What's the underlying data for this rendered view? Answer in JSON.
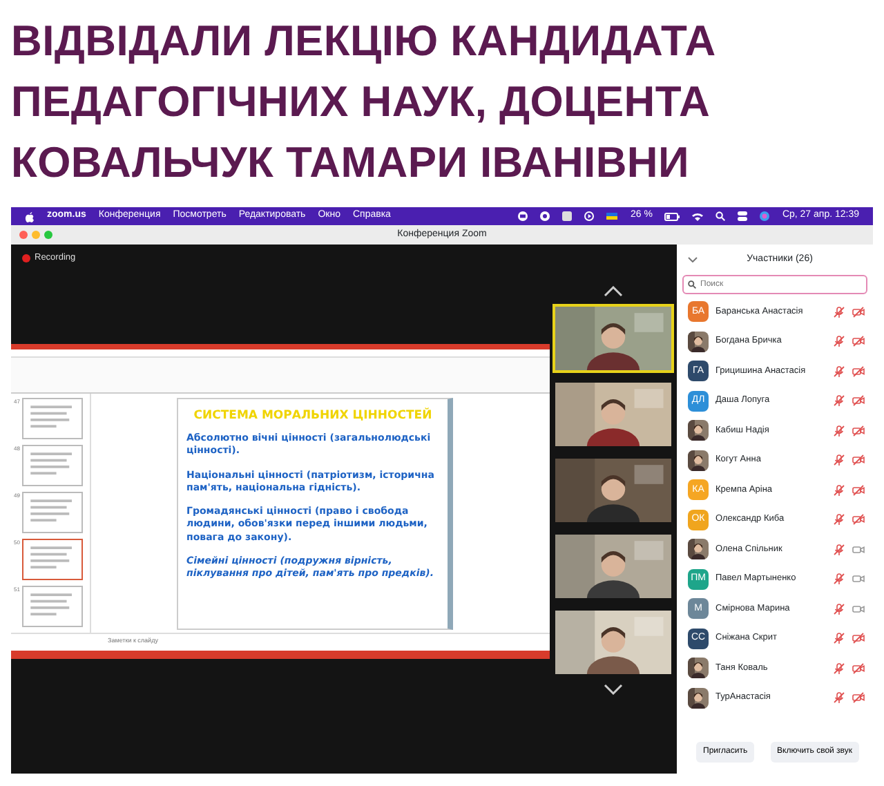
{
  "heading": {
    "lines": [
      "ВІДВІДАЛИ ЛЕКЦІЮ КАНДИДАТА",
      "ПЕДАГОГІЧНИХ НАУК, ДОЦЕНТА",
      "КОВАЛЬЧУК ТАМАРИ ІВАНІВНИ"
    ]
  },
  "menu_bar": {
    "app": "zoom.us",
    "items": [
      "Конференция",
      "Посмотреть",
      "Редактировать",
      "Окно",
      "Справка"
    ],
    "battery": "26 %",
    "clock": "Ср, 27 апр.  12:39"
  },
  "window": {
    "title": "Конференция Zoom"
  },
  "recording": {
    "label": "Recording"
  },
  "presentation": {
    "thumbnails": [
      {
        "number": "47",
        "selected": false
      },
      {
        "number": "48",
        "selected": false
      },
      {
        "number": "49",
        "selected": false
      },
      {
        "number": "50",
        "selected": true
      },
      {
        "number": "51",
        "selected": false
      }
    ],
    "slide": {
      "title": "СИСТЕМА МОРАЛЬНИХ ЦІННОСТЕЙ",
      "paragraphs": [
        {
          "text": "Абсолютно вічні цінності (загальнолюдські цінності).",
          "italic": false
        },
        {
          "text": "Національні цінності (патріотизм, історична пам'ять, національна гідність).",
          "italic": false
        },
        {
          "text": "Громадянські цінності (право і свобода людини, обов'язки перед іншими людьми, повага до закону).",
          "italic": false
        },
        {
          "text": "Сімейні цінності (подружня вірність, піклування про дітей, пам'ять про предків).",
          "italic": true
        }
      ]
    },
    "notes_placeholder": "Заметки к слайду"
  },
  "videos": [
    {
      "active_speaker": true
    },
    {
      "active_speaker": false
    },
    {
      "active_speaker": false
    },
    {
      "active_speaker": false
    },
    {
      "active_speaker": false
    }
  ],
  "participants": {
    "title": "Участники (26)",
    "search": {
      "placeholder": "Поиск"
    },
    "people": [
      {
        "name": "Баранська Анастасія",
        "avatar": {
          "kind": "initials",
          "initials": "БА",
          "color": "#e8772e"
        },
        "muted": true,
        "video_on": false
      },
      {
        "name": "Богдана Бричка",
        "muted": true,
        "video_on": false
      },
      {
        "name": "Грицишина Анастасія",
        "avatar": {
          "kind": "initials",
          "initials": "ГА",
          "color": "#2e4a6b"
        },
        "muted": true,
        "video_on": false
      },
      {
        "name": "Даша Лопуга",
        "avatar": {
          "kind": "initials",
          "initials": "ДЛ",
          "color": "#2d8fd8"
        },
        "muted": true,
        "video_on": false
      },
      {
        "name": "Кабиш Надія",
        "muted": true,
        "video_on": false
      },
      {
        "name": "Когут Анна",
        "muted": true,
        "video_on": false
      },
      {
        "name": "Кремпа Аріна",
        "avatar": {
          "kind": "initials",
          "initials": "КА",
          "color": "#f5a623"
        },
        "muted": true,
        "video_on": false
      },
      {
        "name": "Олександр Киба",
        "avatar": {
          "kind": "initials",
          "initials": "ОК",
          "color": "#f0a51e"
        },
        "muted": true,
        "video_on": false
      },
      {
        "name": "Олена Спільник",
        "muted": true,
        "video_on": true
      },
      {
        "name": "Павел Мартыненко",
        "avatar": {
          "kind": "initials",
          "initials": "ПМ",
          "color": "#1ea58a"
        },
        "muted": true,
        "video_on": true
      },
      {
        "name": "Смірнова Марина",
        "avatar": {
          "kind": "initials",
          "initials": "М",
          "color": "#6d8799"
        },
        "muted": true,
        "video_on": true
      },
      {
        "name": "Сніжана Скрит",
        "avatar": {
          "kind": "initials",
          "initials": "СС",
          "color": "#2e4a6b"
        },
        "muted": true,
        "video_on": false
      },
      {
        "name": "Таня Коваль",
        "muted": true,
        "video_on": false
      },
      {
        "name": "ТурАнастасія",
        "muted": true,
        "video_on": false
      }
    ],
    "buttons": [
      "Пригласить",
      "Включить свой звук"
    ]
  }
}
